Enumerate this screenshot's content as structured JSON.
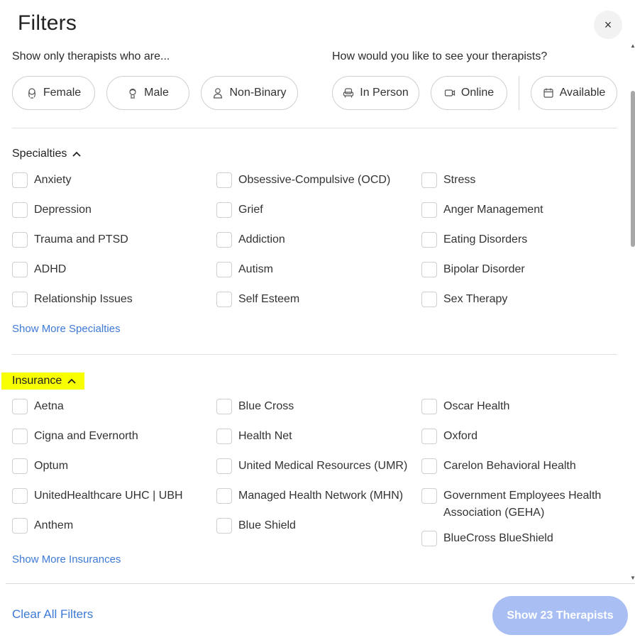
{
  "title": "Filters",
  "close_glyph": "×",
  "gender_prompt": "Show only therapists who are...",
  "mode_prompt": "How would you like to see your therapists?",
  "gender_pills": [
    {
      "label": "Female",
      "icon": "female-head-icon"
    },
    {
      "label": "Male",
      "icon": "male-head-icon"
    },
    {
      "label": "Non-Binary",
      "icon": "person-icon"
    }
  ],
  "mode_pills": [
    {
      "label": "In Person",
      "icon": "armchair-icon"
    },
    {
      "label": "Online",
      "icon": "video-camera-icon"
    },
    {
      "label": "Available",
      "icon": "calendar-icon"
    }
  ],
  "specialties": {
    "heading": "Specialties",
    "columns": [
      [
        "Anxiety",
        "Depression",
        "Trauma and PTSD",
        "ADHD",
        "Relationship Issues"
      ],
      [
        "Obsessive-Compulsive (OCD)",
        "Grief",
        "Addiction",
        "Autism",
        "Self Esteem"
      ],
      [
        "Stress",
        "Anger Management",
        "Eating Disorders",
        "Bipolar Disorder",
        "Sex Therapy"
      ]
    ],
    "show_more": "Show More Specialties"
  },
  "insurance": {
    "heading": "Insurance",
    "highlight_color": "#f7ff00",
    "columns": [
      [
        "Aetna",
        "Cigna and Evernorth",
        "Optum",
        "UnitedHealthcare UHC | UBH",
        "Anthem"
      ],
      [
        "Blue Cross",
        "Health Net",
        "United Medical Resources (UMR)",
        "Managed Health Network (MHN)",
        "Blue Shield"
      ],
      [
        "Oscar Health",
        "Oxford",
        "Carelon Behavioral Health",
        "Government Employees Health Association (GEHA)",
        "BlueCross BlueShield"
      ]
    ],
    "show_more": "Show More Insurances"
  },
  "footer": {
    "clear_label": "Clear All Filters",
    "show_label": "Show 23 Therapists"
  },
  "colors": {
    "link": "#3d7ad6",
    "primary_disabled": "#a9bff3"
  }
}
